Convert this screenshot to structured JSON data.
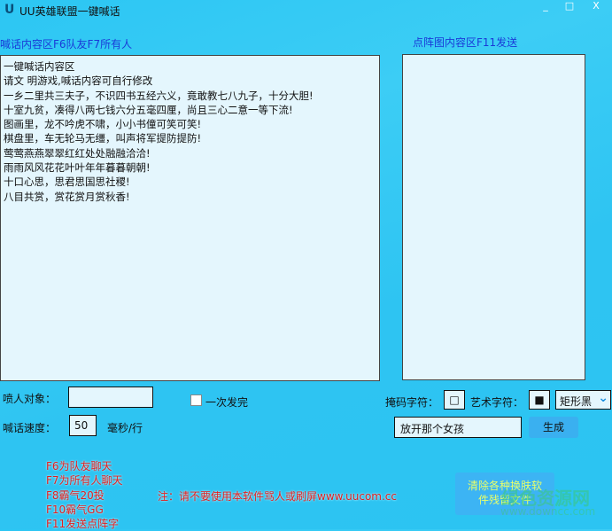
{
  "window": {
    "title": "UU英雄联盟一键喊话",
    "minimize": "_",
    "maximize": "□",
    "close": "X"
  },
  "labels": {
    "content_area": "喊话内容区F6队友F7所有人",
    "matrix_area": "点阵图内容区F11发送",
    "target": "喷人对象：",
    "speed": "喊话速度：",
    "speed_unit": "毫秒/行",
    "once": "一次发完",
    "mask_char": "掩码字符：",
    "art_char": "艺术字符："
  },
  "content_lines": [
    "一键喊话内容区",
    "请文 明游戏,喊话内容可自行修改",
    "一乡二里共三夫子，不识四书五经六义，竟敢教七八九子，十分大胆!",
    "十室九贫，凑得八两七钱六分五毫四厘，尚且三心二意一等下流!",
    "图画里，龙不吟虎不啸，小小书僮可笑可笑!",
    "棋盘里，车无轮马无缰，叫声将军提防提防!",
    "莺莺燕燕翠翠红红处处融融洽洽!",
    "雨雨风风花花叶叶年年暮暮朝朝!",
    "十口心思，思君思国思社稷!",
    "八目共赏，赏花赏月赏秋香!"
  ],
  "inputs": {
    "target": "",
    "speed": "50",
    "mask_char": "□",
    "art_char": "■",
    "shape": "矩形黑",
    "matrix_text": "放开那个女孩"
  },
  "buttons": {
    "generate": "生成",
    "clean": "清除各种换肤软件残留文件"
  },
  "hotkeys": [
    "F6为队友聊天",
    "F7为所有人聊天",
    "F8霸气20投",
    "F10霸气GG",
    "F11发送点阵字"
  ],
  "notice": "注：请不要使用本软件骂人或刷屏www.uucom.cc",
  "watermark": {
    "name": "绿色资源网",
    "url": "www.downcc.com"
  }
}
